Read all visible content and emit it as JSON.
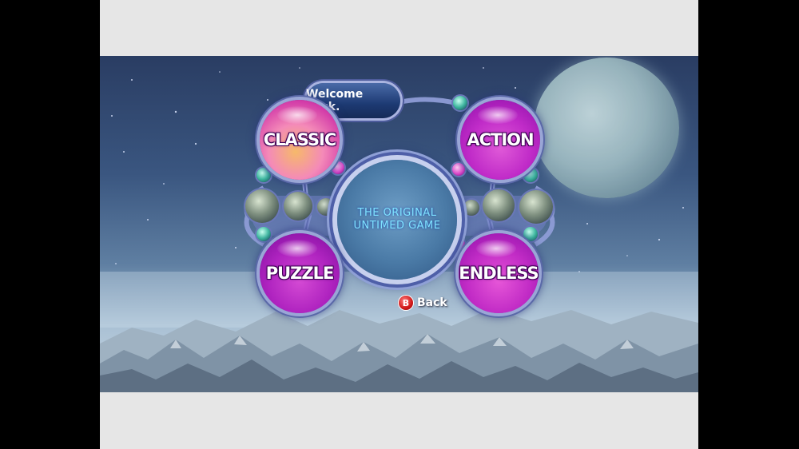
{
  "greeting": "Welcome back.",
  "modes": {
    "classic": "CLASSIC",
    "action": "ACTION",
    "puzzle": "PUZZLE",
    "endless": "ENDLESS"
  },
  "description": {
    "line1": "THE ORIGINAL",
    "line2": "UNTIMED GAME"
  },
  "back": {
    "button_glyph": "B",
    "label": "Back"
  },
  "colors": {
    "mode_ball": "#c02bc8",
    "description_text": "#7fe3ff",
    "back_button": "#d01818"
  }
}
